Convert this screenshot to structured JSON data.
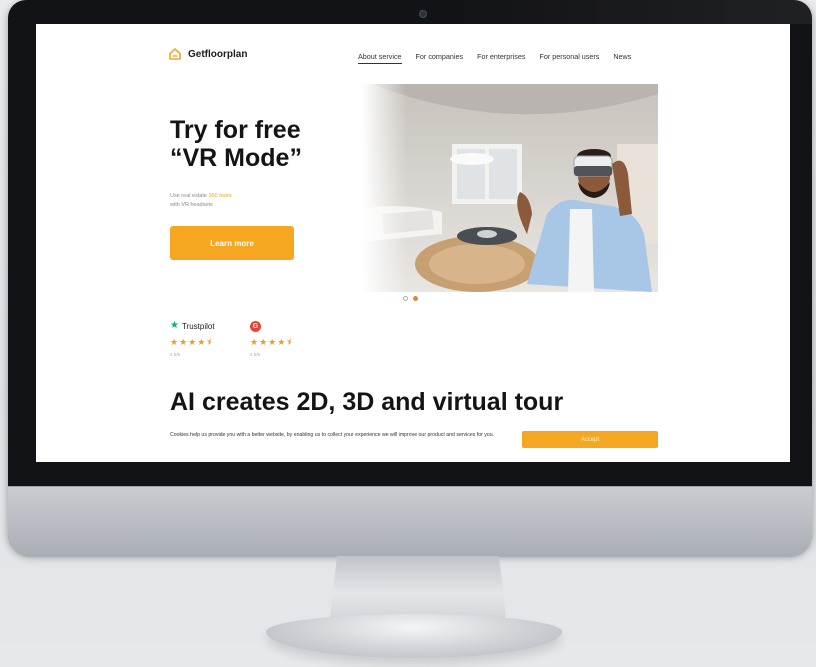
{
  "site": {
    "logo_text": "Getfloorplan",
    "accent_color": "#f5a722"
  },
  "nav": {
    "items": [
      {
        "label": "About service",
        "active": true
      },
      {
        "label": "For companies",
        "active": false
      },
      {
        "label": "For enterprises",
        "active": false
      },
      {
        "label": "For personal users",
        "active": false
      },
      {
        "label": "News",
        "active": false
      }
    ]
  },
  "hero": {
    "title_line1": "Try for free",
    "title_line2": "“VR Mode”",
    "sub_before": "Use real estate ",
    "sub_highlight": "360 tours",
    "sub_after": "with VR headsets",
    "cta_label": "Learn more",
    "image_icon": "vr-headset-photo",
    "carousel": {
      "count": 2,
      "active_index": 1
    }
  },
  "ratings": [
    {
      "brand": "Trustpilot",
      "icon": "trustpilot-star-icon",
      "stars": "★★★★⯨",
      "value": 4.5,
      "score_text": "4.5/5"
    },
    {
      "brand": "",
      "icon": "google-icon",
      "icon_glyph": "G",
      "stars": "★★★★⯨",
      "value": 4.5,
      "score_text": "4.5/5"
    }
  ],
  "section": {
    "title": "AI creates 2D, 3D and virtual tour"
  },
  "cookie": {
    "text": "Cookies help us provide you with a better website, by enabling us to collect your experience we will improve our product and services for you.",
    "accept_label": "Accept"
  }
}
